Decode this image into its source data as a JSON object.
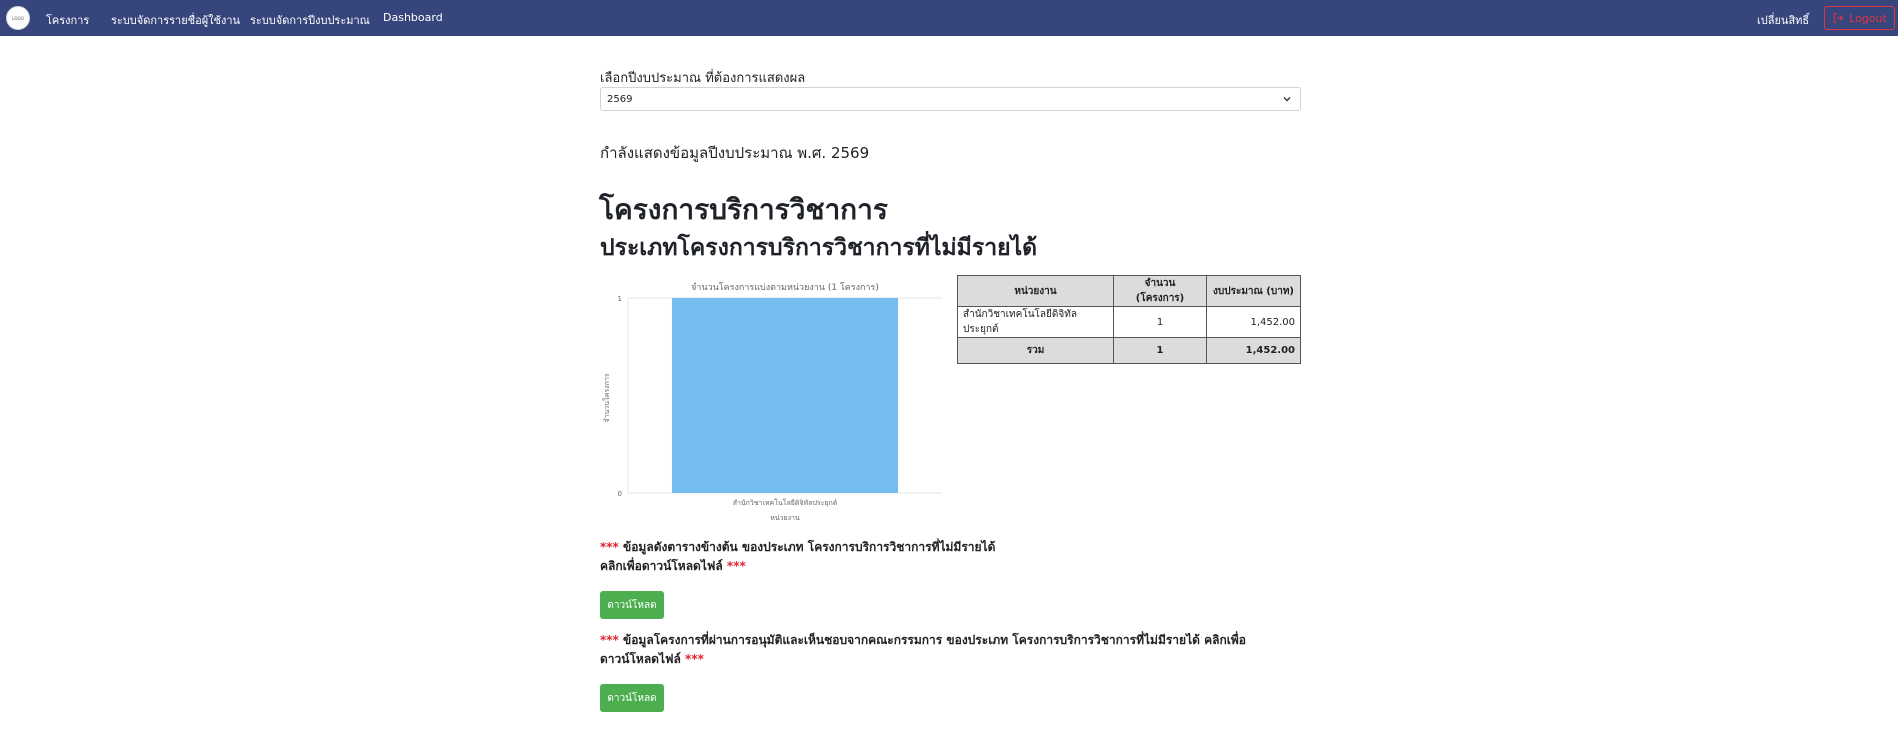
{
  "nav": {
    "logo_text": "LOGO",
    "links": [
      "โครงการ",
      "ระบบจัดการรายชื่อผู้ใช้งาน",
      "ระบบจัดการปีงบประมาณ",
      "Dashboard"
    ],
    "change_rights": "เปลี่ยนสิทธิ์",
    "logout": "Logout"
  },
  "year_select": {
    "label": "เลือกปีงบประมาณ ที่ต้องการแสดงผล",
    "value": "2569"
  },
  "showing": "กำลังแสดงข้อมูลปีงบประมาณ พ.ศ. 2569",
  "title": "โครงการบริการวิชาการ",
  "subtitle": "ประเภทโครงการบริการวิชาการที่ไม่มีรายได้",
  "chart_data": {
    "type": "bar",
    "title": "จำนวนโครงการแบ่งตามหน่วยงาน (1 โครงการ)",
    "categories": [
      "สำนักวิชาเทคโนโลยีดิจิทัลประยุกต์"
    ],
    "values": [
      1
    ],
    "xlabel": "หน่วยงาน",
    "ylabel": "จำนวนโครงการ",
    "ylim": [
      0,
      1
    ],
    "yticks": [
      "1",
      "0"
    ],
    "bar_color": "#74bdf0",
    "grid": true
  },
  "table": {
    "headers": [
      "หน่วยงาน",
      "จำนวน (โครงการ)",
      "งบประมาณ (บาท)"
    ],
    "row": {
      "unit": "สำนักวิชาเทคโนโลยีดิจิทัลประยุกต์",
      "count": "1",
      "budget": "1,452.00"
    },
    "total": {
      "label": "รวม",
      "count": "1",
      "budget": "1,452.00"
    }
  },
  "notes": {
    "stars": "***",
    "note1_line1": "ข้อมูลดังตารางข้างต้น ของประเภท โครงการบริการวิชาการที่ไม่มีรายได้",
    "note1_line2": "คลิกเพื่อดาวน์โหลดไฟล์",
    "note2_line1": "ข้อมูลโครงการที่ผ่านการอนุมัติและเห็นชอบจากคณะกรรมการ ของประเภท โครงการบริการวิชาการที่ไม่มีรายได้ คลิกเพื่อ",
    "note2_line2": "ดาวน์โหลดไฟล์",
    "download_label": "ดาวน์โหลด"
  },
  "colors": {
    "navbar": "#36467c",
    "logout": "#dc3545",
    "download": "#4cae4f",
    "stars": "#e0242f"
  }
}
